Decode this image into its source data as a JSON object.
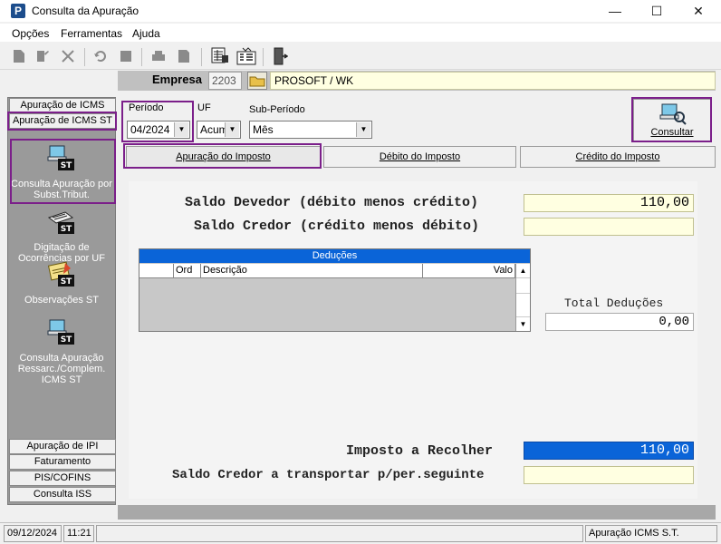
{
  "window": {
    "title": "Consulta da Apuração",
    "app_icon_letter": "P",
    "minimize": "—",
    "maximize": "☐",
    "close": "✕"
  },
  "menu": {
    "items": [
      "Opções",
      "Ferramentas",
      "Ajuda"
    ]
  },
  "empresa": {
    "label": "Empresa",
    "code": "2203",
    "name": "PROSOFT / WK"
  },
  "sidebar": {
    "top_tabs": [
      "Apuração de ICMS",
      "Apuração de ICMS ST"
    ],
    "buttons": [
      "Consulta  Apuração por Subst.Tribut.",
      "Digitação de Ocorrências por UF",
      "Observações ST",
      "Consulta Apuração Ressarc./Complem. ICMS ST"
    ],
    "icon_badge": "ST",
    "bottom_tabs": [
      "Apuração de IPI",
      "Faturamento",
      "PIS/COFINS",
      "Consulta ISS"
    ]
  },
  "filters": {
    "periodo_label": "Período",
    "periodo_value": "04/2024",
    "uf_label": "UF",
    "uf_value": "Acum",
    "subperiodo_label": "Sub-Período",
    "subperiodo_value": "Mês",
    "consultar_label": "Consultar"
  },
  "tabs": [
    "Apuração do Imposto",
    "Débito do Imposto",
    "Crédito do Imposto"
  ],
  "apuracao": {
    "saldo_devedor_label": "Saldo Devedor (débito menos crédito)",
    "saldo_devedor_value": "110,00",
    "saldo_credor_label": "Saldo Credor (crédito menos débito)",
    "saldo_credor_value": "",
    "deducoes_title": "Deduções",
    "deducoes_columns": [
      "Ord",
      "Descrição",
      "Valo"
    ],
    "total_deducoes_label": "Total Deduções",
    "total_deducoes_value": "0,00",
    "imposto_label": "Imposto a Recolher",
    "imposto_value": "110,00",
    "saldo_transportar_label": "Saldo Credor a transportar p/per.seguinte",
    "saldo_transportar_value": ""
  },
  "status": {
    "date": "09/12/2024",
    "time": "11:21",
    "middle": "",
    "screen": "Apuração ICMS S.T."
  },
  "colors": {
    "highlight": "#7b1f8a",
    "selected_blue": "#0a64d8",
    "field_yellow": "#ffffe1"
  }
}
